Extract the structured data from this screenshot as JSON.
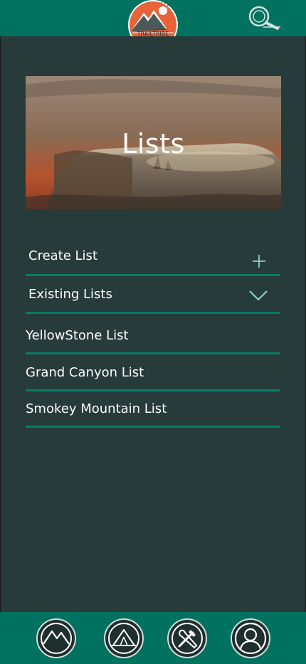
{
  "header": {
    "logo_text": "TRAILTRIBE"
  },
  "hero": {
    "title": "Lists"
  },
  "actions": {
    "create_label": "Create List",
    "existing_label": "Existing Lists"
  },
  "lists": [
    {
      "label": "YellowStone List"
    },
    {
      "label": "Grand Canyon List"
    },
    {
      "label": "Smokey Mountain List"
    }
  ],
  "colors": {
    "header_bg": "#00725f",
    "page_bg": "#273b3a",
    "divider": "#0b7a66",
    "accent": "#8ed0c0"
  },
  "icons": {
    "search": "search-icon",
    "plus": "plus-icon",
    "chevron": "chevron-down-icon",
    "nav": [
      "mountains-icon",
      "tent-icon",
      "tools-icon",
      "profile-icon"
    ]
  }
}
